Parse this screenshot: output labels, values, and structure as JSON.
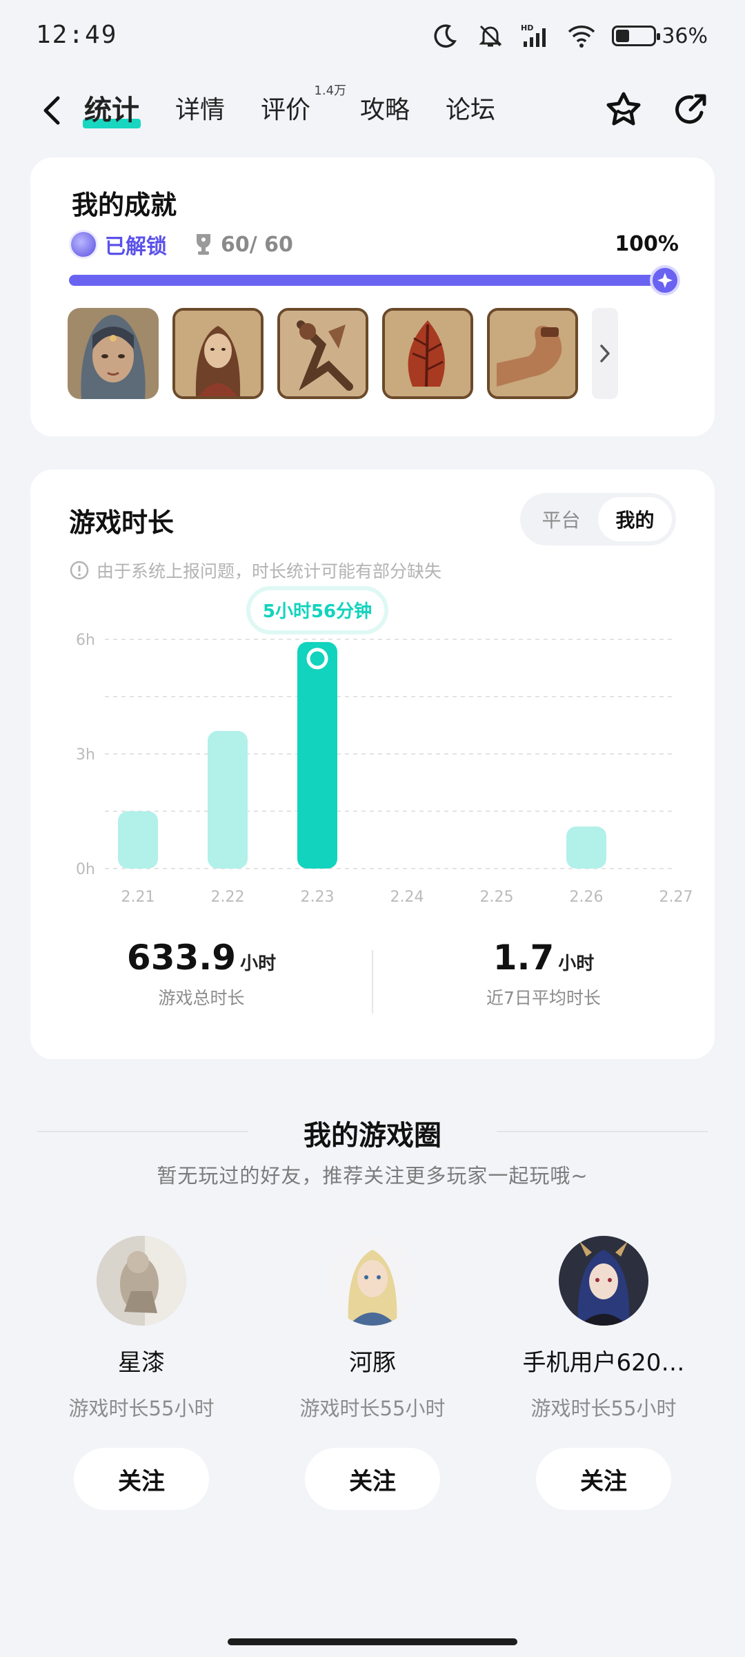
{
  "status_bar": {
    "time": "12:49",
    "battery_percent": "36%",
    "battery_level": 0.36,
    "icons": [
      "moon-icon",
      "bell-off-icon",
      "hd-signal-icon",
      "wifi-icon",
      "battery-icon"
    ]
  },
  "nav": {
    "tabs": [
      {
        "label": "统计",
        "active": true
      },
      {
        "label": "详情",
        "active": false
      },
      {
        "label": "评价",
        "active": false,
        "badge": "1.4万"
      },
      {
        "label": "攻略",
        "active": false
      },
      {
        "label": "论坛",
        "active": false
      }
    ],
    "actions": [
      "star-icon",
      "share-icon"
    ]
  },
  "achievements": {
    "title": "我的成就",
    "unlocked_label": "已解锁",
    "count": "60/ 60",
    "percent": "100%",
    "progress": 1.0,
    "colors": {
      "accent": "#6a63f2"
    }
  },
  "playtime": {
    "title": "游戏时长",
    "toggle": [
      "平台",
      "我的"
    ],
    "toggle_active": "我的",
    "notice": "由于系统上报问题，时长统计可能有部分缺失",
    "tooltip": "5小时56分钟",
    "total_value": "633.9",
    "total_unit": "小时",
    "total_label": "游戏总时长",
    "avg_value": "1.7",
    "avg_unit": "小时",
    "avg_label": "近7日平均时长"
  },
  "chart_data": {
    "type": "bar",
    "categories": [
      "2.21",
      "2.22",
      "2.23",
      "2.24",
      "2.25",
      "2.26",
      "2.27"
    ],
    "values": [
      1.5,
      3.6,
      5.93,
      0,
      0,
      1.1,
      0
    ],
    "highlight_index": 2,
    "y_ticks": [
      "0h",
      "3h",
      "6h"
    ],
    "ylim": [
      0,
      6
    ],
    "grid": true,
    "colors": {
      "bar": "#b2f0ea",
      "highlight": "#12d3bd",
      "tick": "#bbbbbb"
    }
  },
  "game_circle": {
    "title": "我的游戏圈",
    "subtitle": "暂无玩过的好友，推荐关注更多玩家一起玩哦~",
    "friends": [
      {
        "name": "星漆",
        "sub": "游戏时长55小时",
        "follow": "关注"
      },
      {
        "name": "河豚",
        "sub": "游戏时长55小时",
        "follow": "关注"
      },
      {
        "name": "手机用户620…",
        "sub": "游戏时长55小时",
        "follow": "关注"
      }
    ]
  }
}
